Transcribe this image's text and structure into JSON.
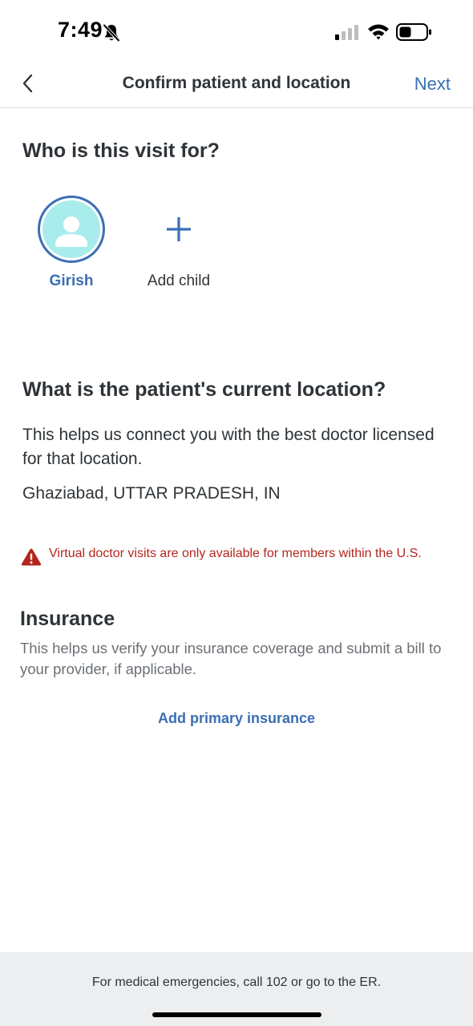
{
  "status_bar": {
    "time": "7:49",
    "icons": [
      "bell-slash-icon",
      "cellular-signal-icon",
      "wifi-icon",
      "battery-icon"
    ]
  },
  "nav": {
    "back_icon": "chevron-left-icon",
    "title": "Confirm patient and location",
    "next_label": "Next"
  },
  "patient_section": {
    "title": "Who is this visit for?",
    "patients": [
      {
        "name": "Girish",
        "selected": true,
        "icon": "person-avatar-icon"
      }
    ],
    "add_child_label": "Add child",
    "add_icon": "plus-icon"
  },
  "location_section": {
    "title": "What is the patient's current location?",
    "description": "This helps us connect you with the best doctor licensed for that location.",
    "current_location": "Ghaziabad, UTTAR PRADESH, IN",
    "warning_icon": "warning-triangle-icon",
    "warning_text": "Virtual doctor visits are only available for members within the U.S."
  },
  "insurance_section": {
    "title": "Insurance",
    "description": "This helps us verify your insurance coverage and submit a bill to your provider, if applicable.",
    "add_label": "Add primary insurance"
  },
  "footer": {
    "text": "For medical emergencies, call 102 or go to the ER."
  },
  "colors": {
    "accent": "#3a6fb4",
    "avatar_bg": "#a9ecec",
    "warning": "#b3261e",
    "footer_bg": "#eceeef"
  }
}
